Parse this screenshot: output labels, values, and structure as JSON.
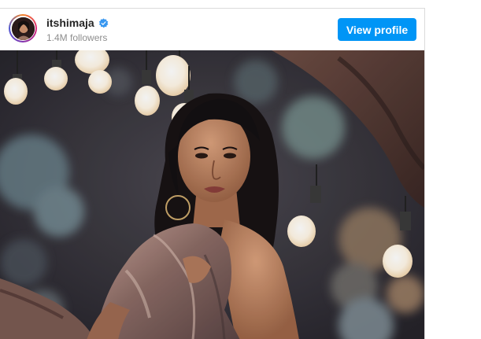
{
  "profile": {
    "username": "itshimaja",
    "verified": true,
    "followers_text": "1.4M followers",
    "view_profile_label": "View profile",
    "button_color": "#0095f6",
    "verified_color": "#3897f0"
  },
  "post": {
    "icons": [
      "avatar-image",
      "verified-badge-icon",
      "post-photo"
    ]
  }
}
